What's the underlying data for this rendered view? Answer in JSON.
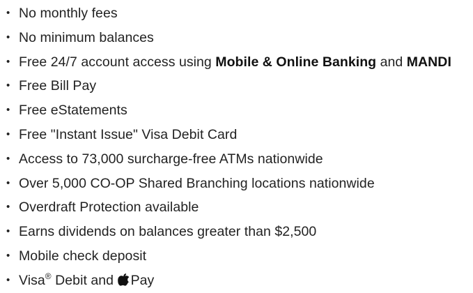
{
  "features": {
    "bullet": "•",
    "items": [
      {
        "text": "No monthly fees"
      },
      {
        "text": "No minimum balances"
      },
      {
        "prefix": "Free 24/7 account access using ",
        "bold1": "Mobile & Online Banking",
        "middle": " and ",
        "bold2": "MANDI"
      },
      {
        "text": "Free Bill Pay"
      },
      {
        "text": "Free eStatements"
      },
      {
        "text": "Free \"Instant Issue\" Visa Debit Card"
      },
      {
        "text": "Access to 73,000 surcharge-free ATMs nationwide"
      },
      {
        "text": "Over 5,000 CO-OP Shared Branching locations nationwide"
      },
      {
        "text": "Overdraft Protection available"
      },
      {
        "text": "Earns dividends on balances greater than $2,500"
      },
      {
        "text": "Mobile check deposit"
      },
      {
        "prefix": "Visa",
        "registered": "®",
        "middle": " Debit and ",
        "icon": "apple-icon",
        "suffix": "Pay"
      }
    ]
  }
}
